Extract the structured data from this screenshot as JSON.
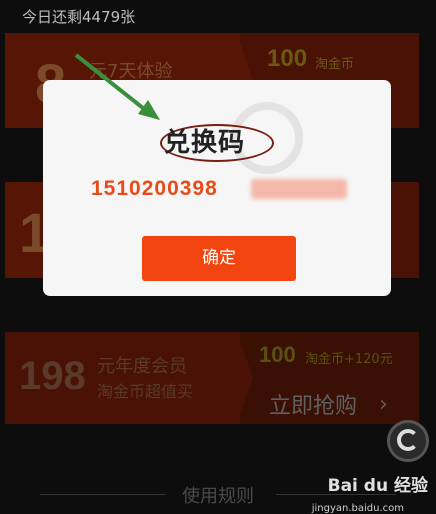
{
  "top_note": "今日还剩4479张",
  "cards": [
    {
      "big": "8",
      "title": "元7天体验",
      "coin_num": "100",
      "coin_unit": "淘金币"
    },
    {
      "big": "1",
      "title": "",
      "coin_num": "",
      "coin_unit": ""
    },
    {
      "big": "198",
      "title": "元年度会员",
      "sub": "淘金币超值买",
      "coin_num": "100",
      "coin_unit": "淘金币+120元",
      "buy": "立即抢购"
    }
  ],
  "dialog": {
    "title": "兑换码",
    "code_prefix": "1510200398",
    "confirm": "确定"
  },
  "rules": "使用规则",
  "watermark": {
    "text": "Bai du 经验",
    "sub": "jingyan.baidu.com"
  },
  "colors": {
    "accent": "#f24510",
    "code": "#e84b1a",
    "arrow": "#3a8f3a"
  }
}
